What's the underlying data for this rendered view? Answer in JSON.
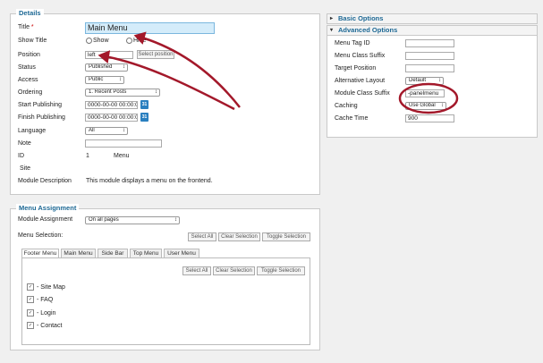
{
  "details": {
    "legend": "Details",
    "title_label": "Title",
    "title_required": "*",
    "title_value": "Main Menu",
    "show_title_label": "Show Title",
    "show_option": "Show",
    "hide_option": "Hide",
    "position_label": "Position",
    "position_value": "left",
    "select_position_button": "Select position",
    "status_label": "Status",
    "status_value": "Published",
    "access_label": "Access",
    "access_value": "Public",
    "ordering_label": "Ordering",
    "ordering_value": "1. Recent Posts",
    "start_publishing_label": "Start Publishing",
    "start_publishing_value": "0000-00-00 00:00:00",
    "finish_publishing_label": "Finish Publishing",
    "finish_publishing_value": "0000-00-00 00:00:00",
    "calendar_glyph": "31",
    "language_label": "Language",
    "language_value": "All",
    "note_label": "Note",
    "note_value": "",
    "id_label": "ID",
    "id_value": "1",
    "menu_label": "Menu",
    "site_label": "Site",
    "description_label": "Module Description",
    "description_value": "This module displays a menu on the frontend."
  },
  "basic_options": {
    "title": "Basic Options"
  },
  "advanced_options": {
    "title": "Advanced Options",
    "menu_tag_id_label": "Menu Tag ID",
    "menu_tag_id_value": "",
    "menu_class_suffix_label": "Menu Class Suffix",
    "menu_class_suffix_value": "",
    "target_position_label": "Target Position",
    "target_position_value": "",
    "alternative_layout_label": "Alternative Layout",
    "alternative_layout_value": "Default",
    "module_class_suffix_label": "Module Class Suffix",
    "module_class_suffix_value": "-panelmenu",
    "caching_label": "Caching",
    "caching_value": "Use Global",
    "cache_time_label": "Cache Time",
    "cache_time_value": "900"
  },
  "menu_assignment": {
    "legend": "Menu Assignment",
    "module_assignment_label": "Module Assignment",
    "module_assignment_value": "On all pages",
    "menu_selection_label": "Menu Selection:",
    "select_all": "Select All",
    "clear_selection": "Clear Selection",
    "toggle_selection": "Toggle Selection",
    "tabs": [
      "Footer Menu",
      "Main Menu",
      "Side Bar",
      "Top Menu",
      "User Menu"
    ],
    "check_glyph": "✓",
    "items": [
      "- Site Map",
      "- FAQ",
      "- Login",
      "- Contact"
    ]
  },
  "colors": {
    "accent": "#1d6894",
    "annotation": "#a3182a",
    "title_field": "#d4ecfa"
  },
  "icons": [
    "calendar-icon",
    "radio-icon",
    "checkbox-icon",
    "triangle-right-icon",
    "triangle-down-icon"
  ]
}
